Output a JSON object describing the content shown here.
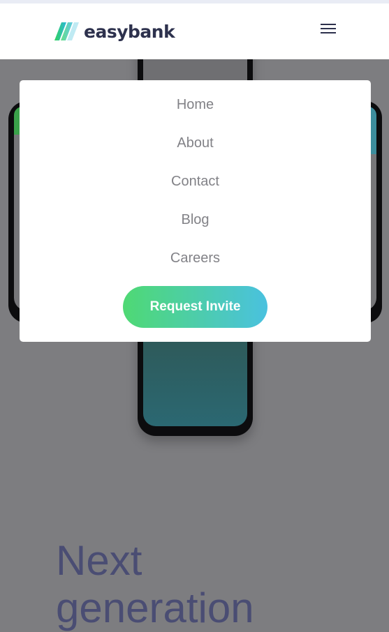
{
  "header": {
    "logo_text": "easybank",
    "menu_icon": "hamburger-icon"
  },
  "mobile_menu": {
    "items": [
      {
        "label": "Home"
      },
      {
        "label": "About"
      },
      {
        "label": "Contact"
      },
      {
        "label": "Blog"
      },
      {
        "label": "Careers"
      }
    ],
    "cta_label": "Request Invite"
  },
  "hero": {
    "headline_line1": "Next",
    "headline_line2": "generation"
  },
  "colors": {
    "dark_blue": "#2d314d",
    "lime_green": "#31d35c",
    "bright_cyan": "#2bb7da",
    "overlay_gray": "#7d7d80",
    "menu_text": "#828287"
  }
}
